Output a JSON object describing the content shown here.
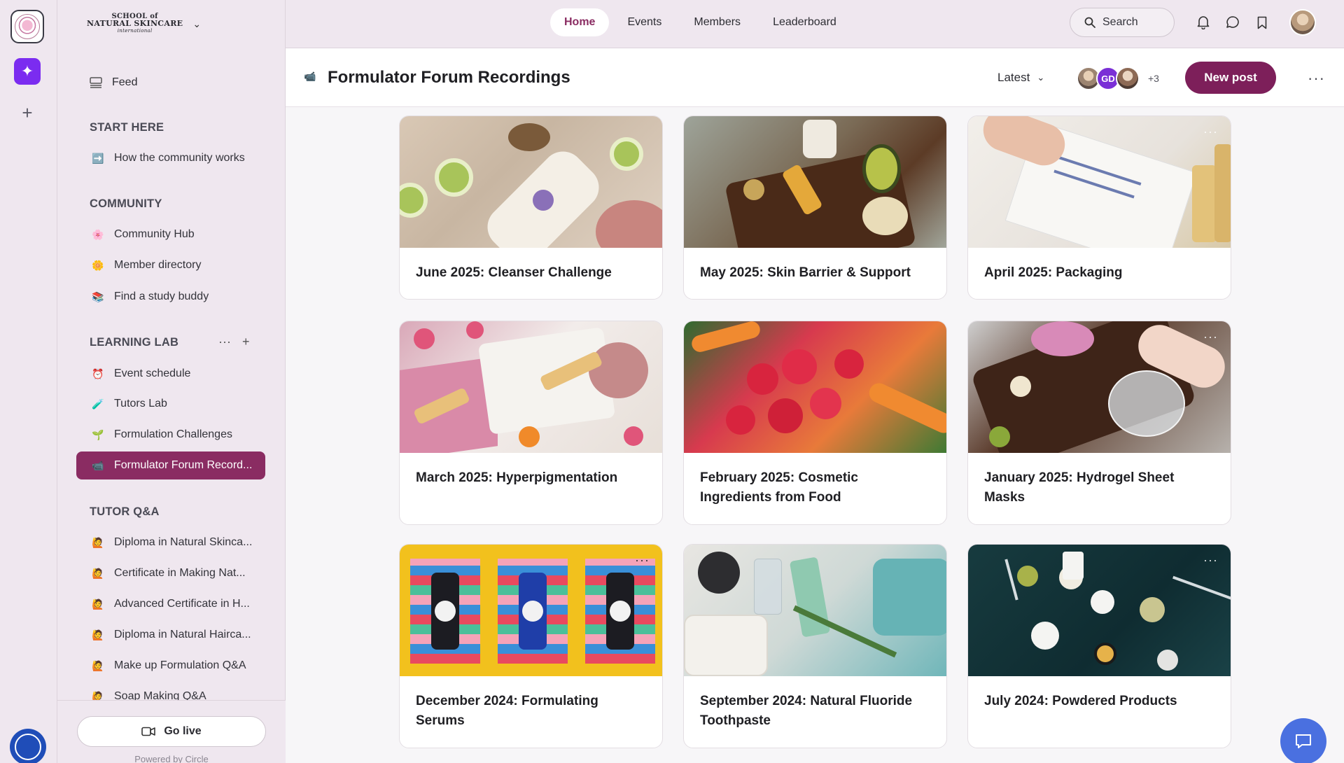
{
  "community": {
    "logo_lines": [
      "SCHOOL of",
      "NATURAL SKINCARE",
      "international"
    ]
  },
  "topnav": {
    "tabs": [
      {
        "label": "Home",
        "active": true
      },
      {
        "label": "Events",
        "active": false
      },
      {
        "label": "Members",
        "active": false
      },
      {
        "label": "Leaderboard",
        "active": false
      }
    ],
    "search_label": "Search"
  },
  "sidebar": {
    "feed_label": "Feed",
    "sections": [
      {
        "title": "START HERE",
        "items": [
          {
            "label": "How the community works",
            "icon": "➡️"
          }
        ]
      },
      {
        "title": "COMMUNITY",
        "items": [
          {
            "label": "Community Hub",
            "icon": "🌸"
          },
          {
            "label": "Member directory",
            "icon": "🌼"
          },
          {
            "label": "Find a study buddy",
            "icon": "📚"
          }
        ]
      },
      {
        "title": "LEARNING LAB",
        "items": [
          {
            "label": "Event schedule",
            "icon": "⏰"
          },
          {
            "label": "Tutors Lab",
            "icon": "🧪"
          },
          {
            "label": "Formulation Challenges",
            "icon": "🌱"
          },
          {
            "label": "Formulator Forum Record...",
            "icon": "📹",
            "active": true
          }
        ]
      },
      {
        "title": "TUTOR Q&A",
        "items": [
          {
            "label": "Diploma in Natural Skinca...",
            "icon": "🙋"
          },
          {
            "label": "Certificate in Making Nat...",
            "icon": "🙋"
          },
          {
            "label": "Advanced Certificate in H...",
            "icon": "🙋"
          },
          {
            "label": "Diploma in Natural Hairca...",
            "icon": "🙋"
          },
          {
            "label": "Make up Formulation Q&A",
            "icon": "🙋"
          },
          {
            "label": "Soap Making Q&A",
            "icon": "🙋"
          }
        ]
      }
    ],
    "go_live_label": "Go live",
    "powered_by": "Powered by Circle"
  },
  "header": {
    "title": "Formulator Forum Recordings",
    "sort_label": "Latest",
    "member_initials": "GD",
    "member_more": "+3",
    "new_post_label": "New post"
  },
  "posts": [
    {
      "title": "June 2025: Cleanser Challenge"
    },
    {
      "title": "May 2025: Skin Barrier & Support"
    },
    {
      "title": "April 2025: Packaging"
    },
    {
      "title": "March 2025: Hyperpigmentation"
    },
    {
      "title": "February 2025: Cosmetic Ingredients from Food"
    },
    {
      "title": "January 2025: Hydrogel Sheet Masks"
    },
    {
      "title": "December 2024: Formulating Serums"
    },
    {
      "title": "September 2024: Natural Fluoride Toothpaste"
    },
    {
      "title": "July 2024: Powdered Products"
    }
  ],
  "colors": {
    "accent": "#7d1f5a",
    "active_nav": "#8a2c62",
    "rail_spark": "#7b2cf0",
    "chat_button": "#4a70e0"
  }
}
